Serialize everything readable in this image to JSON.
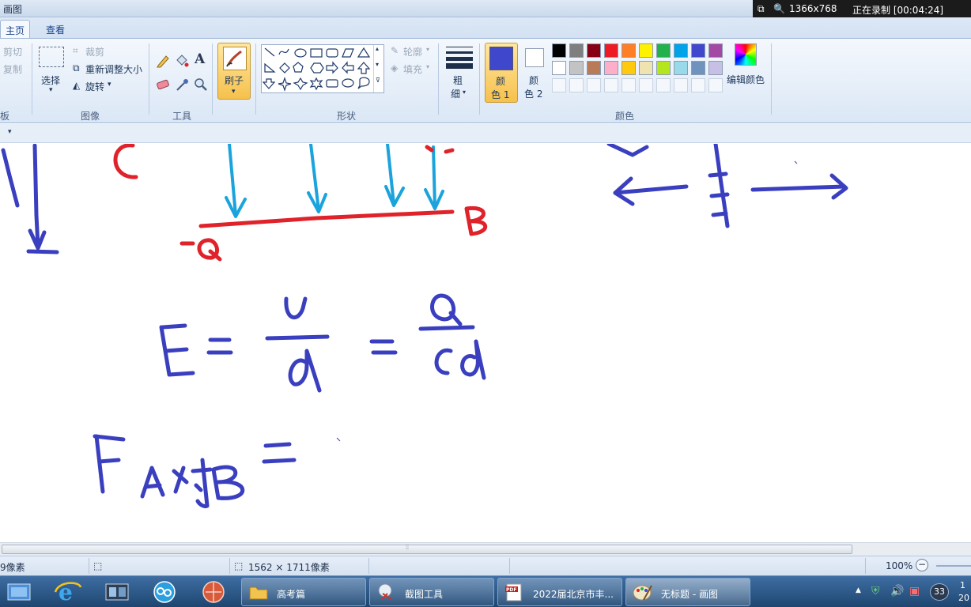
{
  "window": {
    "title": "画图"
  },
  "recorder": {
    "resolution": "1366x768",
    "status": "正在录制 [00:04:24]"
  },
  "tabs": [
    {
      "label": "主页"
    },
    {
      "label": "查看"
    }
  ],
  "ribbon": {
    "clipboard": {
      "cut": "剪切",
      "copy": "复制",
      "group": "板"
    },
    "image": {
      "select": "选择",
      "crop": "裁剪",
      "resize": "重新调整大小",
      "rotate": "旋转",
      "group": "图像"
    },
    "tools": {
      "group": "工具",
      "text_glyph": "A"
    },
    "brushes": {
      "label": "刷子"
    },
    "shapes": {
      "outline": "轮廓",
      "fill": "填充",
      "group": "形状"
    },
    "size": {
      "label_1": "粗",
      "label_2": "细"
    },
    "color1": {
      "label_1": "颜",
      "label_2": "色 1",
      "value": "#3f48cc"
    },
    "color2": {
      "label_1": "颜",
      "label_2": "色 2",
      "value": "#ffffff"
    },
    "palette": {
      "row1": [
        "#000000",
        "#7f7f7f",
        "#880015",
        "#ed1c24",
        "#ff7f27",
        "#fff200",
        "#22b14c",
        "#00a2e8",
        "#3f48cc",
        "#a349a4"
      ],
      "row2": [
        "#ffffff",
        "#c3c3c3",
        "#b97a57",
        "#ffaec9",
        "#ffc90e",
        "#efe4b0",
        "#b5e61d",
        "#99d9ea",
        "#7092be",
        "#c8bfe7"
      ]
    },
    "edit_colors": "编辑颜色",
    "colors_group": "颜色"
  },
  "canvas": {
    "ink_blue": "#3a3fbf",
    "ink_cyan": "#1aa3dc",
    "ink_red": "#e0222a",
    "labels": {
      "c": "C",
      "b": "B",
      "q": "-Q"
    }
  },
  "status": {
    "position": "9像素",
    "dimensions": "1562 × 1711像素",
    "zoom": "100%"
  },
  "taskbar": {
    "buttons": [
      {
        "label": "高考篇"
      },
      {
        "label": "截图工具"
      },
      {
        "label": "2022届北京市丰..."
      },
      {
        "label": "无标题 - 画图"
      }
    ],
    "tray": {
      "badge": "33",
      "clock_1": "1",
      "clock_2": "20"
    }
  }
}
